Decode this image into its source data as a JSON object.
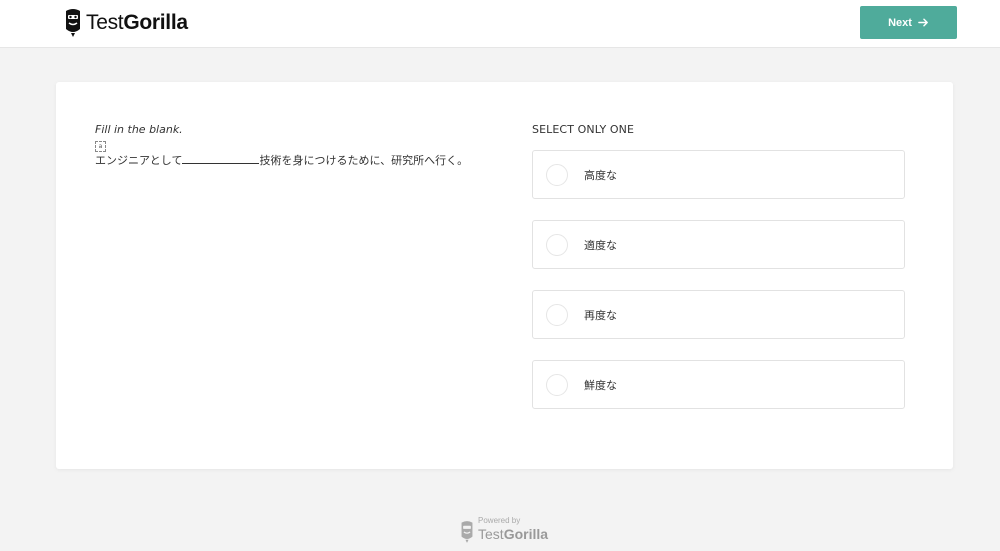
{
  "header": {
    "brand_prefix": "Test",
    "brand_suffix": "Gorilla",
    "next_label": "Next",
    "accent_color": "#4fab9b",
    "next_icon": "arrow-right-icon"
  },
  "question": {
    "instruction": "Fill in the blank.",
    "sentence_before": "エンジニアとして",
    "sentence_after": "技術を身につけるために、研究所へ行く。"
  },
  "answers": {
    "select_label": "SELECT ONLY ONE",
    "options": [
      {
        "label": "高度な"
      },
      {
        "label": "適度な"
      },
      {
        "label": "再度な"
      },
      {
        "label": "鮮度な"
      }
    ]
  },
  "footer": {
    "powered_by": "Powered by",
    "brand_prefix": "Test",
    "brand_suffix": "Gorilla"
  }
}
